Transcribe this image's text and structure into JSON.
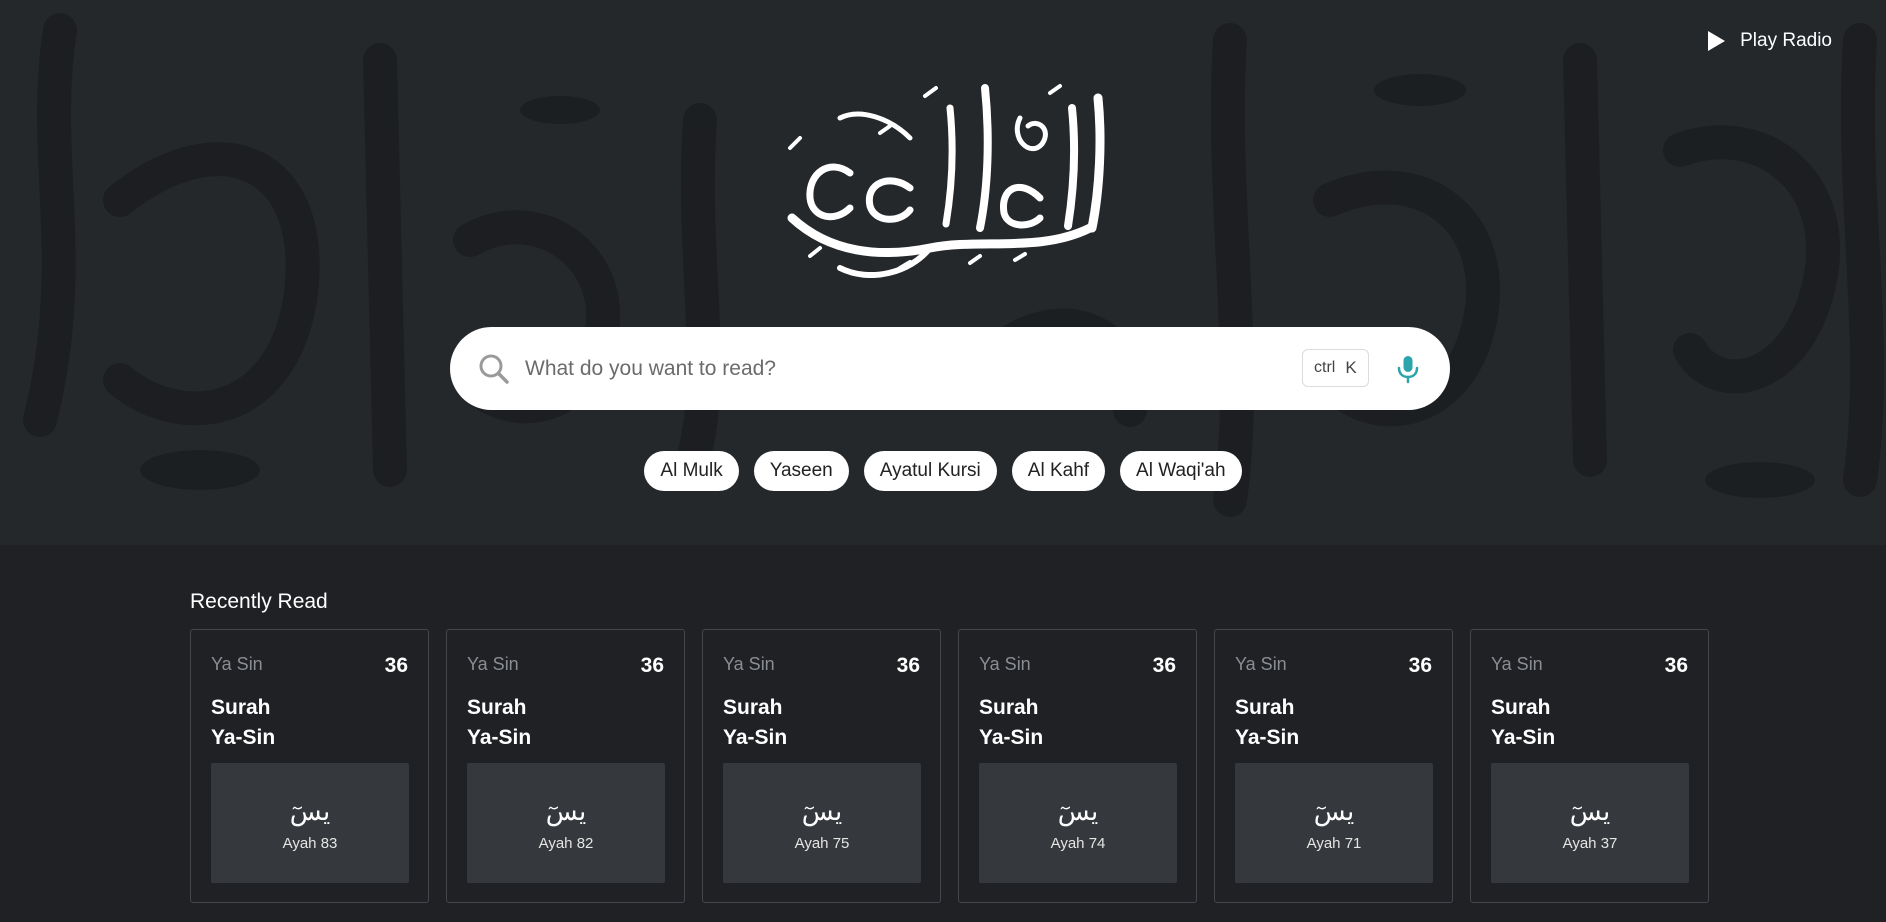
{
  "header": {
    "play_radio_label": "Play Radio",
    "logo_text": "القرآن الكريم"
  },
  "search": {
    "placeholder": "What do you want to read?",
    "shortcut_ctrl": "ctrl",
    "shortcut_key": "K"
  },
  "chips": [
    {
      "label": "Al Mulk"
    },
    {
      "label": "Yaseen"
    },
    {
      "label": "Ayatul Kursi"
    },
    {
      "label": "Al Kahf"
    },
    {
      "label": "Al Waqi'ah"
    }
  ],
  "recent": {
    "heading": "Recently Read",
    "cards": [
      {
        "name": "Ya Sin",
        "number": "36",
        "title_line1": "Surah",
        "title_line2": "Ya-Sin",
        "arabic": "يسٓ",
        "ayah": "Ayah 83"
      },
      {
        "name": "Ya Sin",
        "number": "36",
        "title_line1": "Surah",
        "title_line2": "Ya-Sin",
        "arabic": "يسٓ",
        "ayah": "Ayah 82"
      },
      {
        "name": "Ya Sin",
        "number": "36",
        "title_line1": "Surah",
        "title_line2": "Ya-Sin",
        "arabic": "يسٓ",
        "ayah": "Ayah 75"
      },
      {
        "name": "Ya Sin",
        "number": "36",
        "title_line1": "Surah",
        "title_line2": "Ya-Sin",
        "arabic": "يسٓ",
        "ayah": "Ayah 74"
      },
      {
        "name": "Ya Sin",
        "number": "36",
        "title_line1": "Surah",
        "title_line2": "Ya-Sin",
        "arabic": "يسٓ",
        "ayah": "Ayah 71"
      },
      {
        "name": "Ya Sin",
        "number": "36",
        "title_line1": "Surah",
        "title_line2": "Ya-Sin",
        "arabic": "يسٓ",
        "ayah": "Ayah 37"
      }
    ]
  },
  "colors": {
    "background": "#1f2125",
    "hero_background": "#25282b",
    "card_border": "#44474b",
    "card_inner": "#35383c",
    "mic_accent": "#2ca4ab",
    "muted_text": "#8a8d91"
  },
  "icons": {
    "play": "play-icon",
    "search": "search-icon",
    "mic": "microphone-icon"
  }
}
